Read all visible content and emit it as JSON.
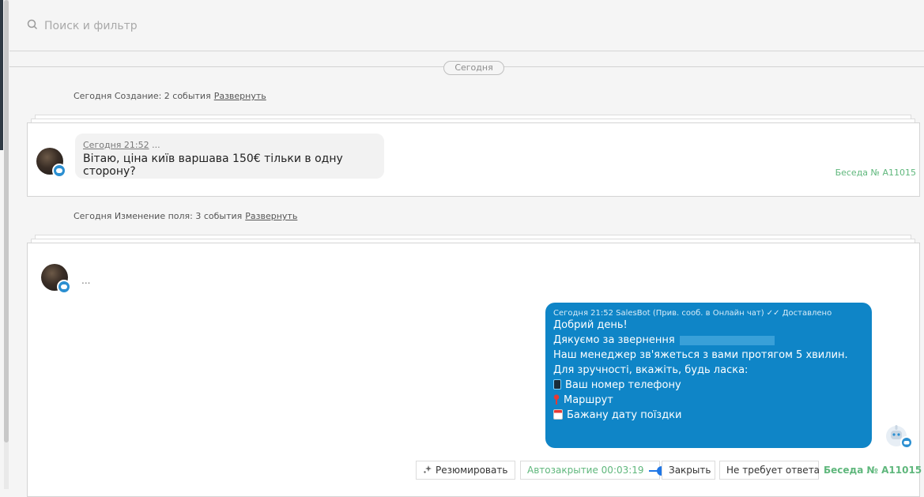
{
  "search": {
    "placeholder": "Поиск и фильтр"
  },
  "timeline": {
    "day_label": "Сегодня",
    "group1": {
      "text": "Сегодня Создание: 2 события",
      "expand": "Развернуть"
    },
    "group2": {
      "text": "Сегодня Изменение поля: 3 события",
      "expand": "Развернуть"
    }
  },
  "card1": {
    "time": "Сегодня 21:52",
    "author": "...",
    "message": "Вітаю, ціна київ варшава 150€ тільки в одну сторону?",
    "conversation": "Беседа № A11015"
  },
  "card2": {
    "author": "...",
    "bot_message": {
      "meta": "Сегодня 21:52 SalesBot (Прив. сооб. в Онлайн чат) ✓✓ Доставлено",
      "line1": "Добрий день!",
      "line2": "Дякуємо за звернення",
      "line3": "Наш менеджер зв'яжеться з вами протягом 5 хвилин.",
      "line4": "Для зручності, вкажіть, будь ласка:",
      "line5": "Ваш номер телефону",
      "line6": "Маршрут",
      "line7": "Бажану дату поїздки"
    },
    "actions": {
      "summarize": "Резюмировать",
      "autoclose": "Автозакрытие 00:03:19",
      "close": "Закрыть",
      "no_reply": "Не требует ответа",
      "conversation": "Беседа № A11015"
    }
  },
  "colors": {
    "bubble_out": "#0f85c7",
    "accent_green": "#5fb77c",
    "toggle_blue": "#1e76e6"
  },
  "icons": [
    "search-icon",
    "sparkle-icon",
    "phone-icon",
    "pin-icon",
    "calendar-icon",
    "chat-badge-icon",
    "bot-avatar-icon"
  ]
}
